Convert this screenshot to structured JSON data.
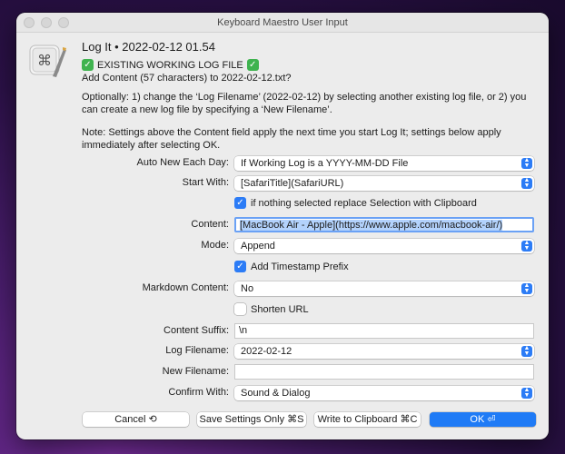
{
  "window": {
    "title": "Keyboard Maestro User Input"
  },
  "header": {
    "title": "Log It • 2022-02-12 01.54",
    "status": "EXISTING WORKING LOG FILE",
    "subtitle": "Add Content (57 characters) to 2022-02-12.txt?"
  },
  "paragraphs": {
    "optional": "Optionally: 1) change the ‘Log Filename’ (2022-02-12) by selecting another existing log file, or 2) you can create a new log file by specifying a ‘New Filename’.",
    "note": "Note: Settings above the Content field apply the next time you start Log It; settings below apply immediately after selecting OK."
  },
  "form": {
    "auto_new_label": "Auto New Each Day:",
    "auto_new_value": "If Working Log is a YYYY-MM-DD File",
    "start_with_label": "Start With:",
    "start_with_value": "[SafariTitle](SafariURL)",
    "replace_selection_label": "if nothing selected replace Selection with Clipboard",
    "replace_selection_checked": true,
    "content_label": "Content:",
    "content_value": "[MacBook Air - Apple](https://www.apple.com/macbook-air/)",
    "mode_label": "Mode:",
    "mode_value": "Append",
    "timestamp_label": "Add Timestamp Prefix",
    "timestamp_checked": true,
    "markdown_label": "Markdown Content:",
    "markdown_value": "No",
    "shorten_label": "Shorten URL",
    "shorten_checked": false,
    "suffix_label": "Content Suffix:",
    "suffix_value": "\\n",
    "log_filename_label": "Log Filename:",
    "log_filename_value": "2022-02-12",
    "new_filename_label": "New Filename:",
    "new_filename_value": "",
    "confirm_label": "Confirm With:",
    "confirm_value": "Sound & Dialog"
  },
  "buttons": {
    "cancel": "Cancel ⟲",
    "save": "Save Settings Only  ⌘S",
    "clipboard": "Write to Clipboard  ⌘C",
    "ok": "OK ⏎"
  },
  "colors": {
    "accent": "#1f7bf6",
    "check": "#3fb34f"
  },
  "icons": {
    "app": "keyboard-maestro-icon",
    "select_arrows": "chevron-updown-icon",
    "check": "checkmark-icon"
  }
}
